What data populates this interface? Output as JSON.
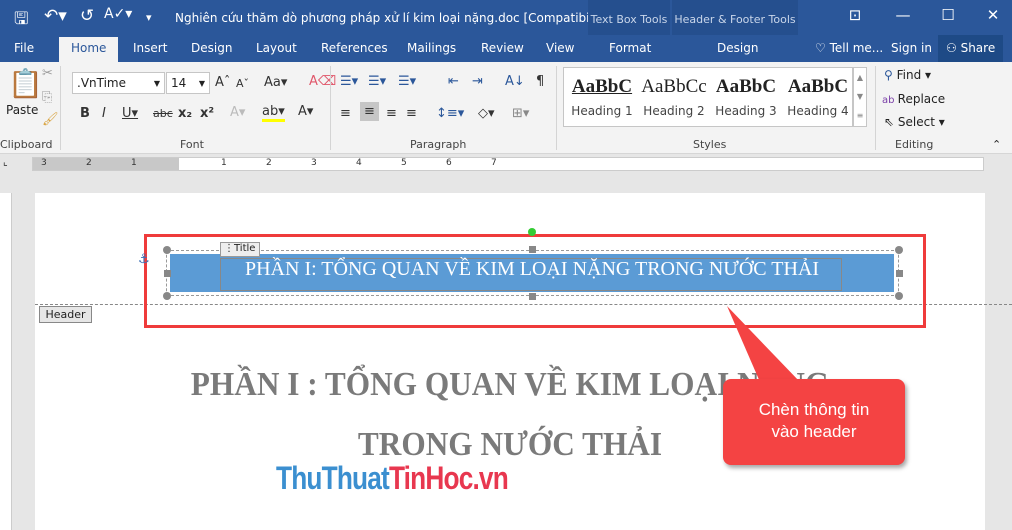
{
  "titlebar": {
    "document_title": "Nghiên cứu thăm dò phương pháp xử lí kim loại nặng.doc [Compatibility...",
    "context_textbox": "Text Box Tools",
    "context_headerfooter": "Header & Footer Tools"
  },
  "tabs": [
    "File",
    "Home",
    "Insert",
    "Design",
    "Layout",
    "References",
    "Mailings",
    "Review",
    "View",
    "Format",
    "Design"
  ],
  "tell_me": "Tell me...",
  "sign_in": "Sign in",
  "share": "Share",
  "clipboard": {
    "paste": "Paste",
    "label": "Clipboard"
  },
  "font": {
    "name": "VnTime",
    "name_display": ".VnTime",
    "size": "14",
    "label": "Font",
    "case": "Aa"
  },
  "paragraph": {
    "label": "Paragraph"
  },
  "styles": {
    "label": "Styles",
    "items": [
      {
        "preview": "AaBbC",
        "name": "Heading 1"
      },
      {
        "preview": "AaBbCc",
        "name": "Heading 2"
      },
      {
        "preview": "AaBbC",
        "name": "Heading 3"
      },
      {
        "preview": "AaBbC",
        "name": "Heading 4"
      }
    ]
  },
  "editing": {
    "label": "Editing",
    "find": "Find",
    "replace": "Replace",
    "select": "Select"
  },
  "ruler": {
    "ticks": [
      "3",
      "2",
      "1",
      "",
      "1",
      "2",
      "3",
      "4",
      "5",
      "6",
      "7"
    ]
  },
  "header": {
    "title_tag": "Title",
    "text": "PHẦN I: TỔNG QUAN VỀ KIM LOẠI NẶNG TRONG NƯỚC THẢI",
    "label": "Header"
  },
  "body": {
    "line1": "PHẦN I : TỔNG QUAN VỀ KIM LOẠI NẶNG",
    "line2": "TRONG NƯỚC THẢI"
  },
  "callout": {
    "line1": "Chèn thông tin",
    "line2": "vào header"
  },
  "watermark": {
    "part1": "ThuThuat",
    "part2": "TinHoc",
    "part3": ".vn"
  },
  "colors": {
    "word_blue": "#2b579a",
    "header_band": "#5b9bd5",
    "callout_red": "#f44343"
  }
}
